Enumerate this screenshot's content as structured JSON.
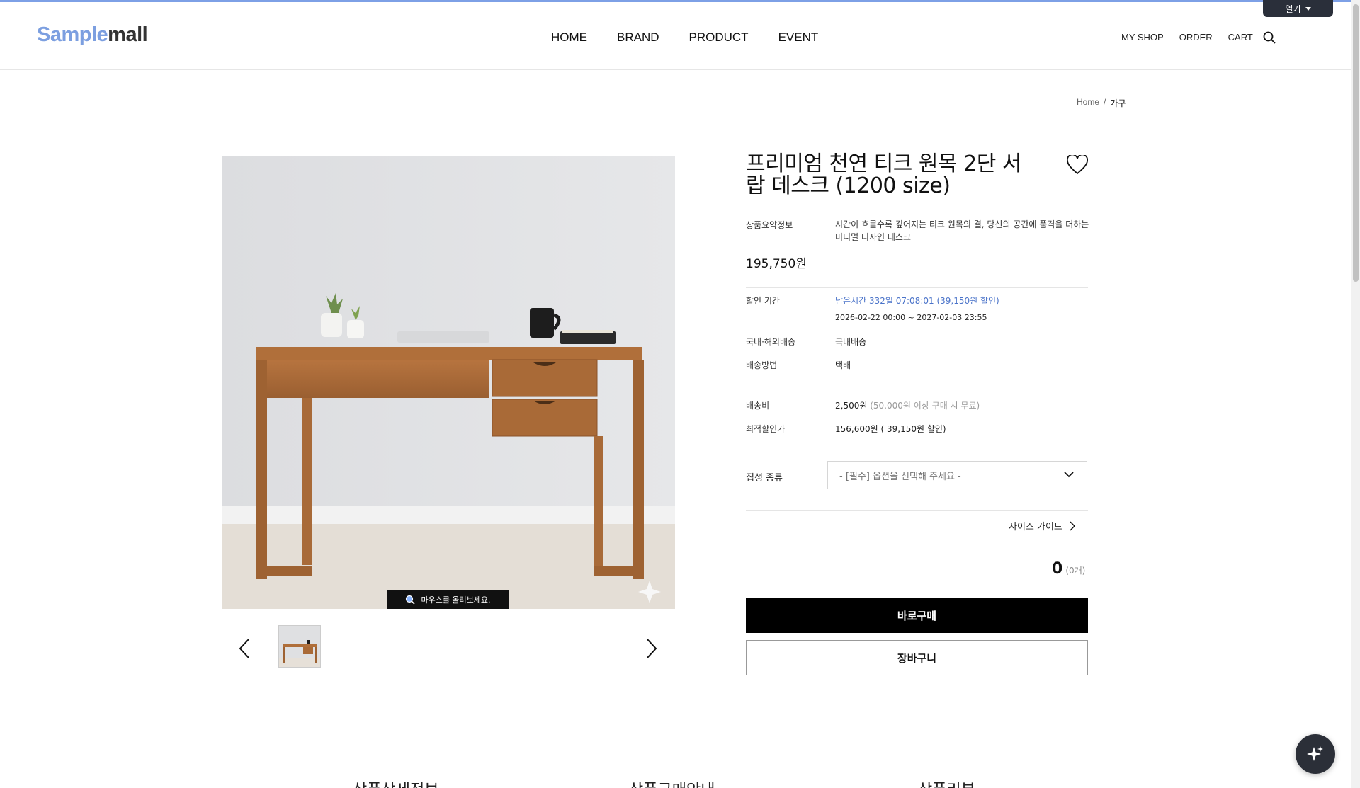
{
  "topbar": {
    "open_label": "열기"
  },
  "header": {
    "logo_part1": "Sample",
    "logo_part2": "mall",
    "nav": [
      "HOME",
      "BRAND",
      "PRODUCT",
      "EVENT"
    ],
    "util": [
      "MY SHOP",
      "ORDER",
      "CART"
    ],
    "search_icon": "search-icon"
  },
  "breadcrumb": {
    "home": "Home",
    "sep": "/",
    "current": "가구"
  },
  "gallery": {
    "hover_hint": "마우스를 올려보세요.",
    "prev_icon": "chevron-left-icon",
    "next_icon": "chevron-right-icon"
  },
  "product": {
    "title": "프리미엄 천연 티크 원목 2단 서랍 데스크 (1200 size)",
    "summary_label": "상품요약정보",
    "summary_text": "시간이 흐를수록 깊어지는 티크 원목의 결, 당신의 공간에 품격을 더하는 미니멀 디자인 데스크",
    "price": "195,750원",
    "discount_label": "할인 기간",
    "discount_remaining": "남은시간 332일 07:08:01 (39,150원 할인)",
    "discount_period": "2026-02-22 00:00 ~ 2027-02-03 23:55",
    "shipping_scope_label": "국내·해외배송",
    "shipping_scope": "국내배송",
    "shipping_method_label": "배송방법",
    "shipping_method": "택배",
    "shipping_fee_label": "배송비",
    "shipping_fee": "2,500원",
    "shipping_fee_note": "(50,000원 이상 구매 시 무료)",
    "best_price_label": "최적할인가",
    "best_price": "156,600원",
    "best_price_note": "( 39,150원 할인)",
    "option_label": "집성 종류",
    "option_placeholder": "- [필수] 옵션을 선택해 주세요 -",
    "size_guide": "사이즈 가이드",
    "total_amount": "0",
    "total_count": "(0개)",
    "buy_now": "바로구매",
    "add_cart": "장바구니"
  },
  "tabs": [
    "상품상세정보",
    "상품구매안내",
    "상품리뷰"
  ],
  "colors": {
    "brand_blue": "#7c9fe0",
    "link_blue": "#4a73c9",
    "button_black": "#000000"
  }
}
